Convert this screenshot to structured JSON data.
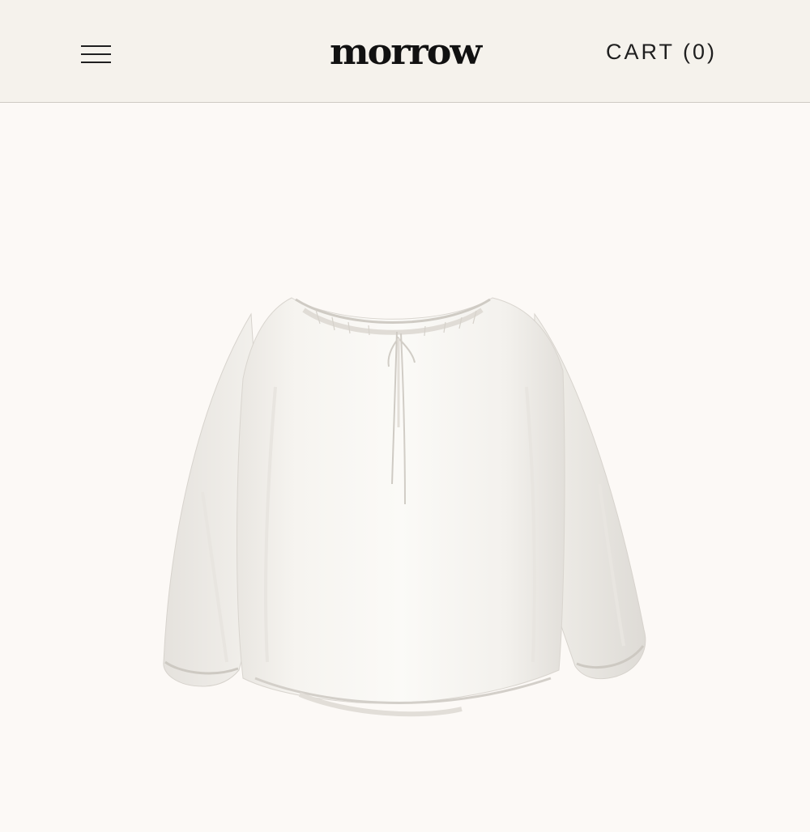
{
  "header": {
    "menu_icon": "hamburger-menu-icon",
    "logo_text": "morrow",
    "cart_label": "CART (0)"
  },
  "product": {
    "image_description_icon": "white-blouse-image"
  },
  "colors": {
    "header_bg": "#f5f2ec",
    "page_bg": "#fcf9f6",
    "text": "#1f1f1f"
  }
}
